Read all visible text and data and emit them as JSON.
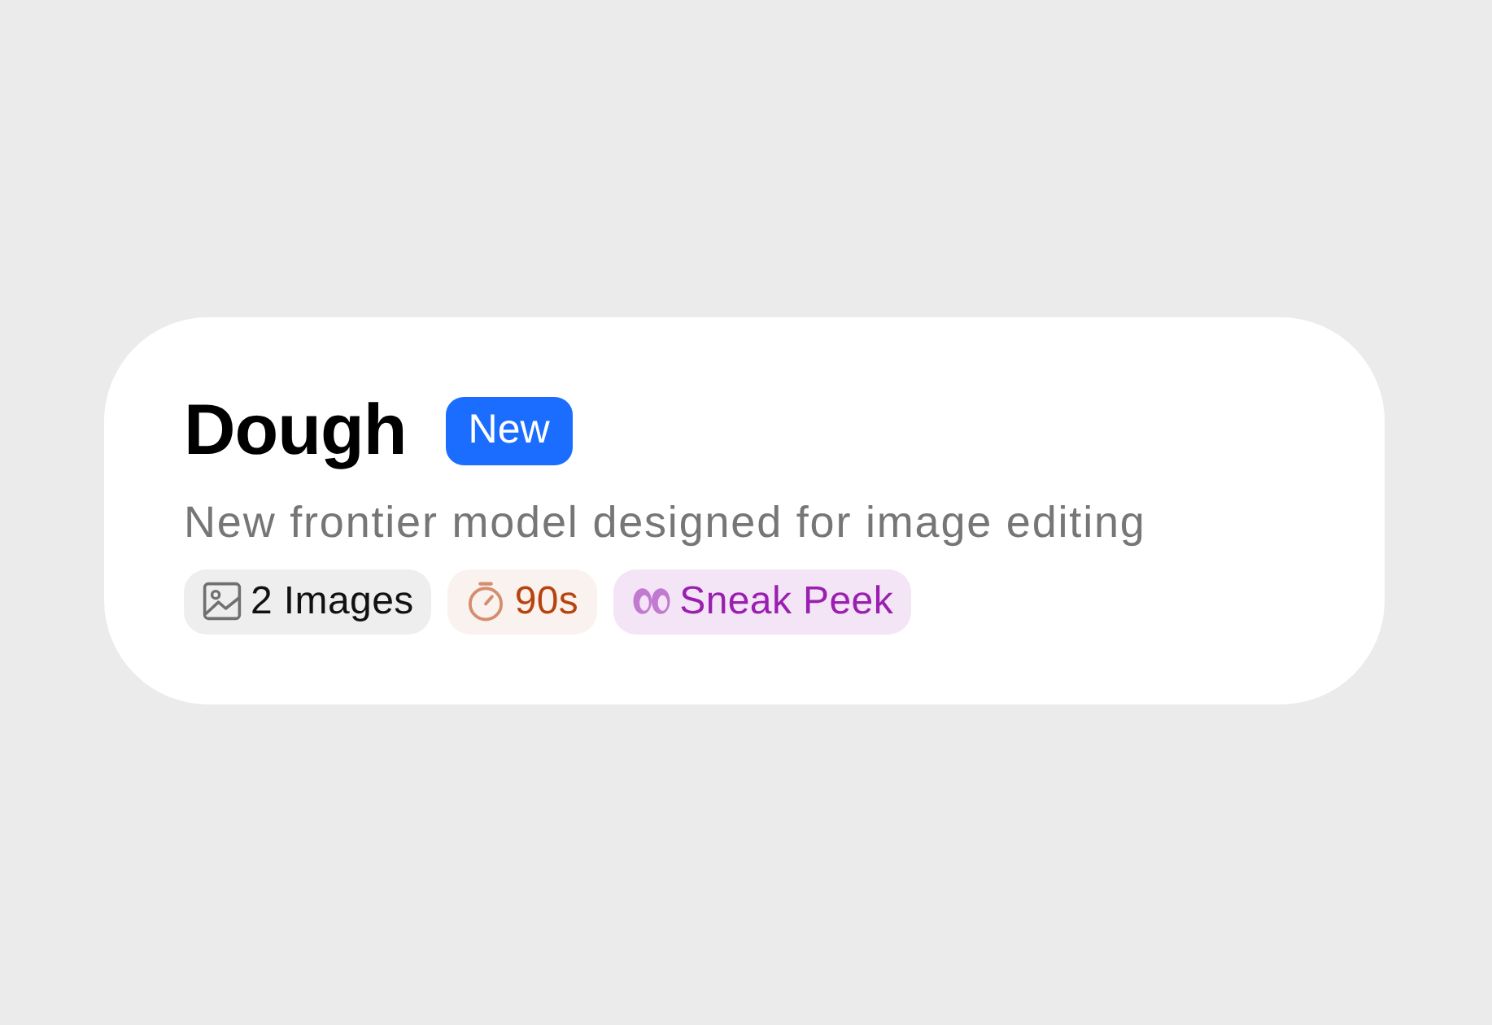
{
  "card": {
    "title": "Dough",
    "badge": "New",
    "description": "New frontier model designed for image editing",
    "tags": [
      {
        "kind": "images",
        "label": "2 Images",
        "color": "#111111"
      },
      {
        "kind": "timer",
        "label": "90s",
        "color": "#b8430e"
      },
      {
        "kind": "eyes",
        "label": "Sneak Peek",
        "color": "#9a1fb0"
      }
    ]
  }
}
